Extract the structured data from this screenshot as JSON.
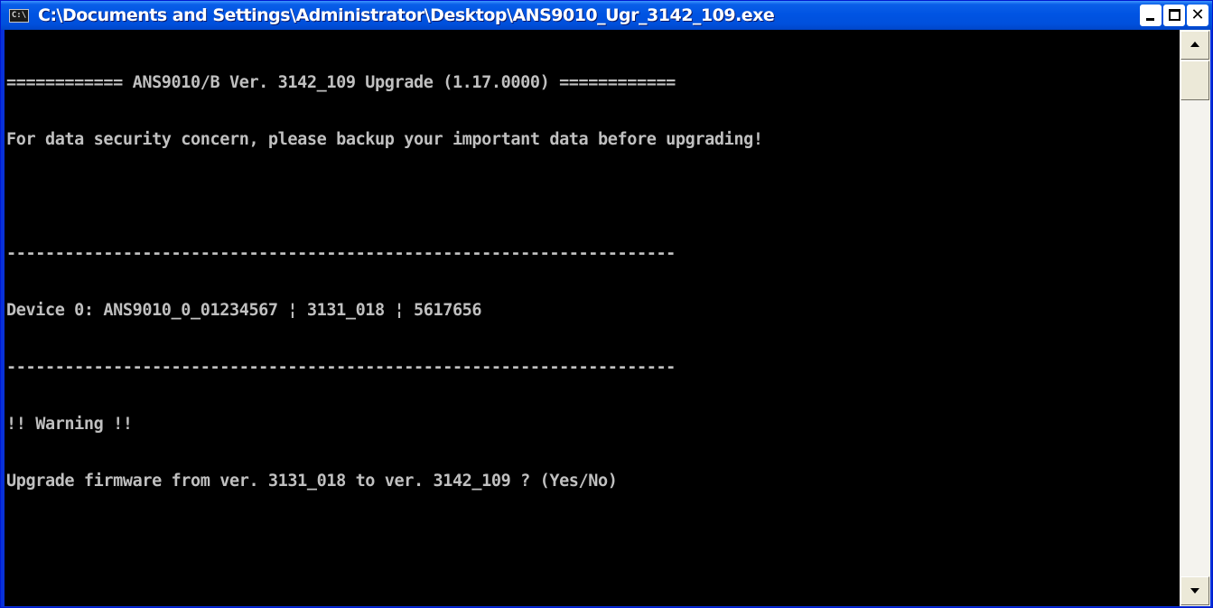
{
  "window": {
    "title": "C:\\Documents and Settings\\Administrator\\Desktop\\ANS9010_Ugr_3142_109.exe",
    "icon": "console-icon",
    "icon_text": "C:\\"
  },
  "console": {
    "lines": [
      "============ ANS9010/B Ver. 3142_109 Upgrade (1.17.0000) ============",
      "For data security concern, please backup your important data before upgrading!",
      "",
      "---------------------------------------------------------------------",
      "Device 0: ANS9010_0_01234567 ¦ 3131_018 ¦ 5617656",
      "---------------------------------------------------------------------",
      "!! Warning !!",
      "Upgrade firmware from ver. 3131_018 to ver. 3142_109 ? (Yes/No)"
    ]
  },
  "colors": {
    "titlebar": "#0054e3",
    "console_background": "#000000",
    "console_text": "#c0c0c0"
  }
}
